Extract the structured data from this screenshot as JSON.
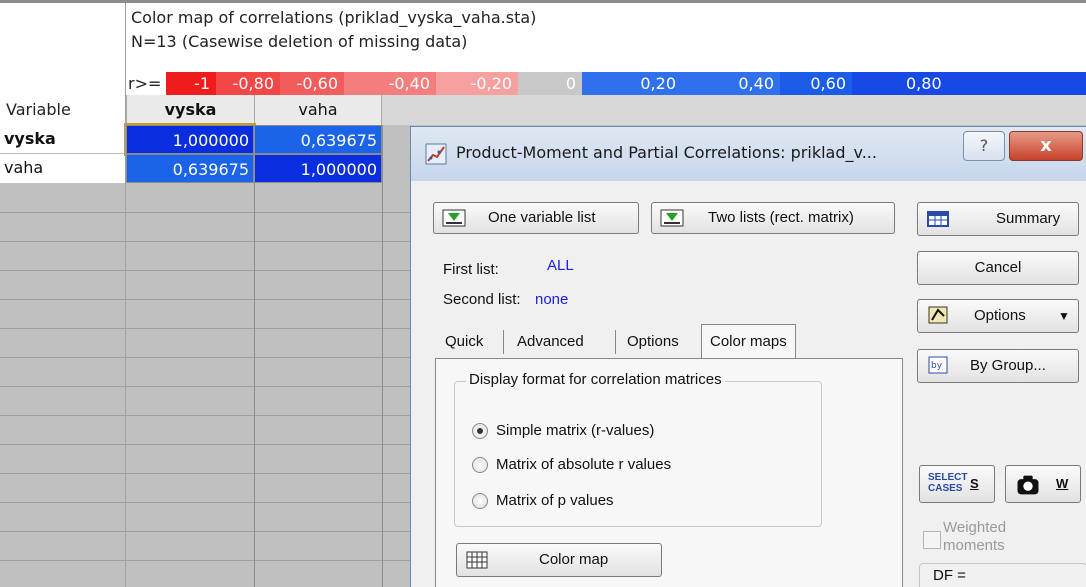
{
  "sheet": {
    "title_line": "Color map of correlations (priklad_vyska_vaha.sta)",
    "n_line": "N=13 (Casewise deletion of missing data)",
    "legend_label": "r>=",
    "legend": [
      {
        "label": "-1",
        "color": "#ee1c1c"
      },
      {
        "label": "-0,80",
        "color": "#f24747"
      },
      {
        "label": "-0,60",
        "color": "#f35c5c"
      },
      {
        "label": "-0,40",
        "color": "#f47d7d"
      },
      {
        "label": "-0,20",
        "color": "#f6a0a0"
      },
      {
        "label": "0",
        "color": "#c8c8c8"
      },
      {
        "label": "0,20",
        "color": "#2f70ec"
      },
      {
        "label": "0,40",
        "color": "#2f70ec"
      },
      {
        "label": "0,60",
        "color": "#1b5ce9"
      },
      {
        "label": "0,80",
        "color": "#1749e4"
      }
    ],
    "variable_header": "Variable",
    "columns": [
      "vyska",
      "vaha"
    ],
    "rows": [
      {
        "name": "vyska",
        "values": [
          "1,000000",
          "0,639675"
        ]
      },
      {
        "name": "vaha",
        "values": [
          "0,639675",
          "1,000000"
        ]
      }
    ],
    "colors": {
      "strong_positive": "#0b2de0",
      "positive": "#1b63e9"
    }
  },
  "dialog": {
    "title": "Product-Moment and Partial Correlations: priklad_v...",
    "help_label": "?",
    "close_label": "x",
    "one_variable_list": "One variable list",
    "two_lists": "Two lists (rect. matrix)",
    "first_list_label": "First list:",
    "first_list_value": "ALL",
    "second_list_label": "Second list:",
    "second_list_value": "none",
    "tabs": [
      "Quick",
      "Advanced",
      "Options",
      "Color maps"
    ],
    "active_tab": "Color maps",
    "group_title": "Display format for correlation matrices",
    "radios": [
      {
        "label": "Simple matrix (r-values)",
        "checked": true
      },
      {
        "label": "Matrix of absolute r values",
        "checked": false
      },
      {
        "label": "Matrix of p values",
        "checked": false
      }
    ],
    "color_map_button": "Color map",
    "summary_button": "Summary",
    "cancel_button": "Cancel",
    "options_button": "Options",
    "by_group_button": "By Group...",
    "select_cases_icon_text": "SELECT CASES",
    "select_cases_hotkey": "S",
    "weight_hotkey": "W",
    "weighted_moments_label": "Weighted moments",
    "df_label": "DF ="
  }
}
